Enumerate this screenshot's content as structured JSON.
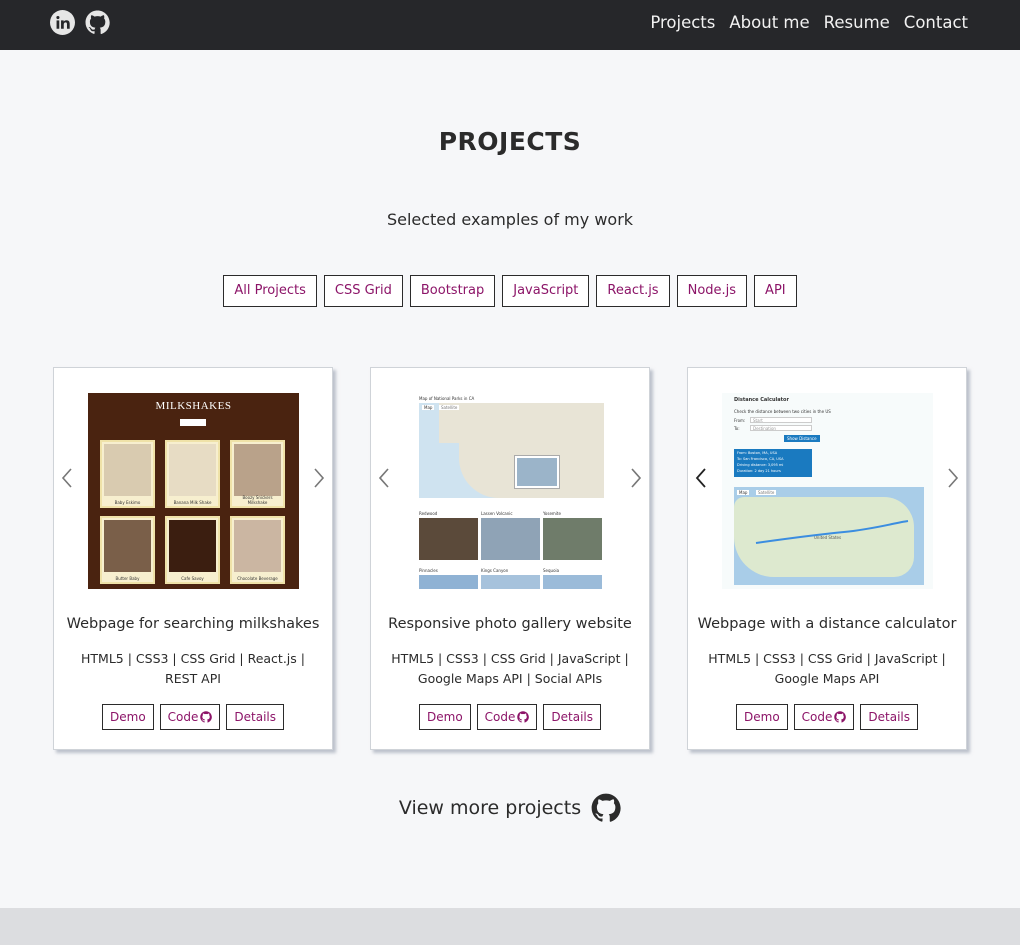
{
  "nav": {
    "social": [
      {
        "icon": "linkedin-icon"
      },
      {
        "icon": "github-icon"
      }
    ],
    "links": [
      "Projects",
      "About me",
      "Resume",
      "Contact"
    ]
  },
  "page": {
    "title": "PROJECTS",
    "subtitle": "Selected examples of my work"
  },
  "filters": [
    "All Projects",
    "CSS Grid",
    "Bootstrap",
    "JavaScript",
    "React.js",
    "Node.js",
    "API"
  ],
  "cards": [
    {
      "title": "Webpage for searching milkshakes",
      "tech": "HTML5 | CSS3 | CSS Grid | React.js | REST API",
      "demo": "Demo",
      "code": "Code",
      "details": "Details",
      "thumb": {
        "heading": "MILKSHAKES",
        "captions": [
          "Baby Eskimo",
          "Banana Milk Shake",
          "Boozy Snickers Milkshake",
          "Butter Baby",
          "Cafe Savoy",
          "Chocolate Beverage"
        ]
      }
    },
    {
      "title": "Responsive photo gallery website",
      "tech": "HTML5 | CSS3 | CSS Grid | JavaScript | Google Maps API | Social APIs",
      "demo": "Demo",
      "code": "Code",
      "details": "Details",
      "thumb": {
        "heading": "Map of National Parks in CA",
        "map_tabs": [
          "Map",
          "Satellite"
        ],
        "captions": [
          "Redwood",
          "Lassen Volcanic",
          "Yosemite",
          "Pinnacles",
          "Kings Canyon",
          "Sequoia"
        ]
      }
    },
    {
      "title": "Webpage with a distance calculator",
      "tech": "HTML5 | CSS3 | CSS Grid | JavaScript | Google Maps API",
      "demo": "Demo",
      "code": "Code",
      "details": "Details",
      "thumb": {
        "heading": "Distance Calculator",
        "intro": "Check the distance between two cities in the US",
        "from_label": "From:",
        "from_placeholder": "Start",
        "to_label": "To:",
        "to_placeholder": "Destination",
        "button": "Show Distance",
        "result": [
          "From: Boston, MA, USA",
          "To: San Francisco, CA, USA",
          "Driving distance: 3,095 mi",
          "Duration: 2 day 21 hours"
        ],
        "map_tabs": [
          "Map",
          "Satellite"
        ],
        "map_label": "United States"
      }
    }
  ],
  "view_more": {
    "label": "View more projects",
    "icon": "github-icon"
  },
  "colors": {
    "navbar": "#26272a",
    "accent": "#8c1468",
    "background": "#f6f7f9",
    "footer": "#dcdde0"
  }
}
